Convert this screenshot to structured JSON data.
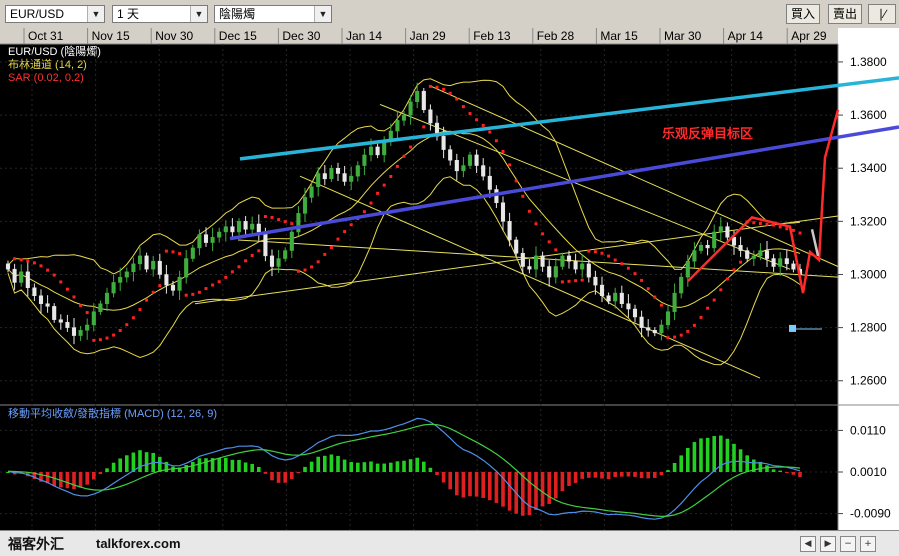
{
  "toolbar": {
    "symbol": "EUR/USD",
    "period": "1 天",
    "chart_style": "陰陽燭",
    "buy_label": "買入",
    "sell_label": "賣出",
    "extra_label": "∣∕"
  },
  "status_bar": {
    "brand": "福客外汇",
    "site": "talkforex.com"
  },
  "colors": {
    "background": "#000000",
    "bollinger": "#e8d94a",
    "sar": "#ff2020",
    "bull_candle": "#3fae3f",
    "bear_candle": "#e8e8e8",
    "trend_cyan": "#27b4d8",
    "trend_blue": "#4a4ad8",
    "annotation": "#ff2a2a",
    "macd_line": "#4f8fe8",
    "signal_line": "#3fd040",
    "hist_pos": "#22d022",
    "hist_neg": "#e02020"
  },
  "chart_data": [
    {
      "type": "candlestick",
      "legend": [
        "EUR/USD (陰陽燭)",
        "布林通道 (14, 2)",
        "SAR (0.02, 0.2)"
      ],
      "x_ticks": [
        "Oct 31",
        "Nov 15",
        "Nov 30",
        "Dec 15",
        "Dec 30",
        "Jan 14",
        "Jan 29",
        "Feb 13",
        "Feb 28",
        "Mar 15",
        "Mar 30",
        "Apr 14",
        "Apr 29"
      ],
      "y_ticks": [
        "1.3800",
        "1.3600",
        "1.3400",
        "1.3200",
        "1.3000",
        "1.2800",
        "1.2600"
      ],
      "ylim": [
        1.252,
        1.386
      ],
      "annotation": "乐观反弹目标区",
      "close": [
        1.302,
        1.297,
        1.301,
        1.295,
        1.292,
        1.289,
        1.288,
        1.283,
        1.282,
        1.28,
        1.277,
        1.279,
        1.281,
        1.286,
        1.289,
        1.293,
        1.297,
        1.299,
        1.301,
        1.304,
        1.307,
        1.302,
        1.305,
        1.3,
        1.296,
        1.294,
        1.299,
        1.306,
        1.31,
        1.315,
        1.312,
        1.314,
        1.316,
        1.318,
        1.316,
        1.32,
        1.317,
        1.319,
        1.316,
        1.307,
        1.303,
        1.306,
        1.309,
        1.316,
        1.323,
        1.329,
        1.333,
        1.338,
        1.336,
        1.34,
        1.338,
        1.335,
        1.337,
        1.341,
        1.345,
        1.348,
        1.345,
        1.35,
        1.354,
        1.358,
        1.36,
        1.365,
        1.369,
        1.362,
        1.357,
        1.352,
        1.347,
        1.343,
        1.339,
        1.341,
        1.345,
        1.341,
        1.337,
        1.332,
        1.327,
        1.32,
        1.313,
        1.308,
        1.303,
        1.302,
        1.307,
        1.303,
        1.299,
        1.303,
        1.307,
        1.305,
        1.302,
        1.304,
        1.299,
        1.296,
        1.292,
        1.29,
        1.293,
        1.289,
        1.287,
        1.284,
        1.28,
        1.279,
        1.278,
        1.281,
        1.286,
        1.293,
        1.299,
        1.305,
        1.309,
        1.311,
        1.31,
        1.316,
        1.318,
        1.314,
        1.311,
        1.309,
        1.306,
        1.307,
        1.309,
        1.306,
        1.303,
        1.306,
        1.304,
        1.302,
        1.3
      ],
      "macd": {
        "label": "移動平均收斂/發散指標 (MACD) (12, 26, 9)",
        "y_ticks": [
          "0.0110",
          "0.0010",
          "-0.0090"
        ],
        "ylim": [
          -0.0115,
          0.0135
        ]
      }
    }
  ]
}
